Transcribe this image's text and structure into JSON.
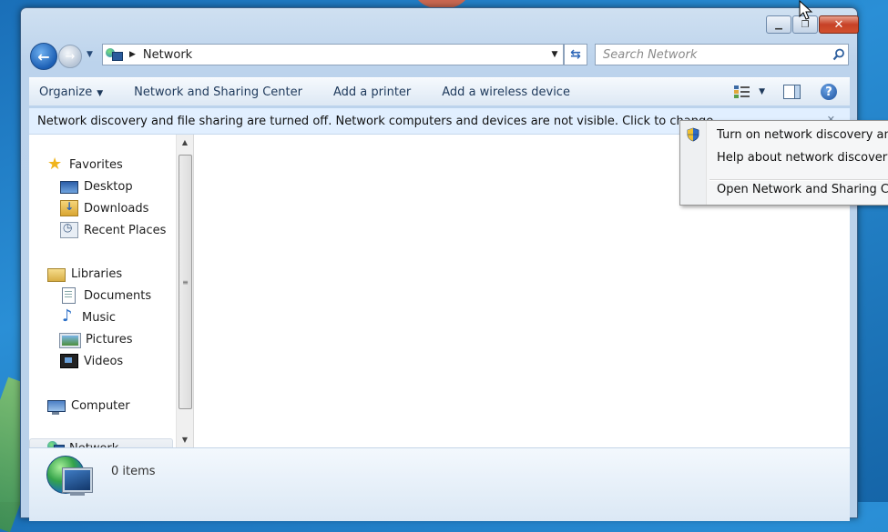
{
  "window": {
    "title": "Network"
  },
  "colors": {
    "accent": "#1c5fb4",
    "infobar": "#e1efff",
    "close": "#c64126"
  },
  "address": {
    "location": "Network"
  },
  "search": {
    "placeholder": "Search Network"
  },
  "toolbar": {
    "organize": "Organize",
    "network_sharing_center": "Network and Sharing Center",
    "add_printer": "Add a printer",
    "add_wireless": "Add a wireless device"
  },
  "infobar": {
    "message": "Network discovery and file sharing are turned off. Network computers and devices are not visible. Click to change..."
  },
  "nav": {
    "favorites": "Favorites",
    "desktop": "Desktop",
    "downloads": "Downloads",
    "recent_places": "Recent Places",
    "libraries": "Libraries",
    "documents": "Documents",
    "music": "Music",
    "pictures": "Pictures",
    "videos": "Videos",
    "computer": "Computer",
    "network": "Network"
  },
  "details": {
    "items_count": "0 items"
  },
  "context_menu": {
    "item1": "Turn on network discovery and",
    "item2": "Help about network discovery",
    "item3": "Open Network and Sharing Cen"
  },
  "icons": [
    "shield-icon",
    "search-icon",
    "refresh-icon",
    "help-icon",
    "view-options-icon",
    "preview-pane-icon",
    "star-icon",
    "network-icon"
  ]
}
